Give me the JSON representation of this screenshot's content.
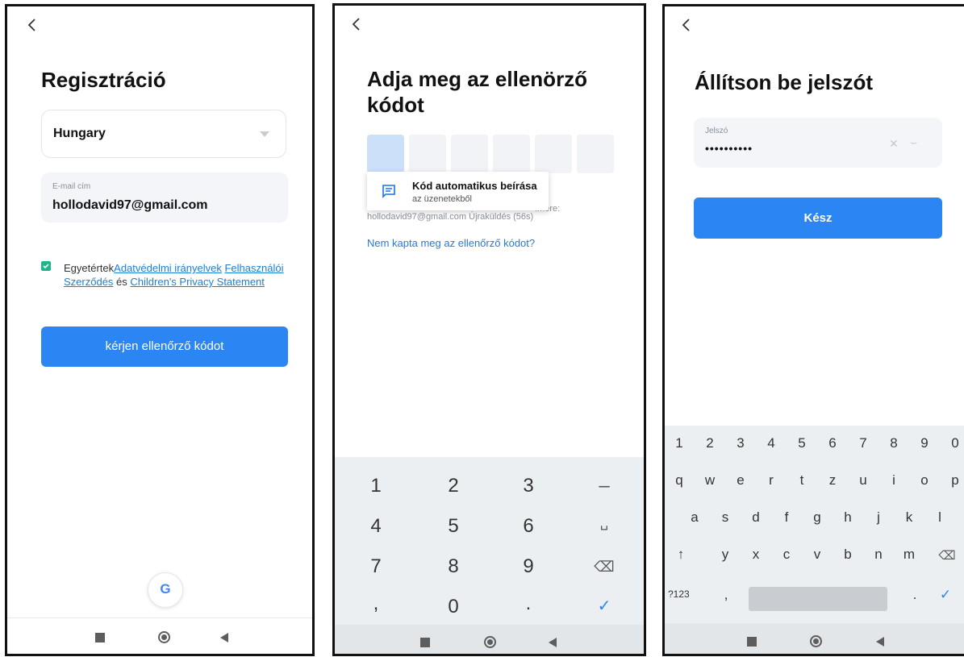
{
  "register": {
    "title": "Regisztráció",
    "country": "Hungary",
    "email_label": "E-mail cím",
    "email_value": "hollodavid97@gmail.com",
    "agree_prefix": "Egyetértek",
    "privacy_link": "Adatvédelmi irányelvek",
    "terms_link": "Felhasználói Szerződés",
    "and": "és",
    "children_link": "Children's Privacy Statement",
    "request_button": "kérjen ellenőrző kódot",
    "google_letter": "G"
  },
  "verify": {
    "title_line1": "Adja meg az ellenörző",
    "title_line2": "kódot",
    "popup_title": "Kód automatikus beírása",
    "popup_sub": "az üzenetekből",
    "sent_suffix": "ímére:",
    "sent_to": "hollodavid97@gmail.com Újraküldés (56s)",
    "not_received": "Nem kapta meg az ellenőrző kódot?",
    "keys": [
      "1",
      "2",
      "3",
      "–",
      "4",
      "5",
      "6",
      "␣",
      "7",
      "8",
      "9",
      "⌫",
      ",",
      "0",
      ".",
      "✓"
    ]
  },
  "password": {
    "title": "Állítson be jelszót",
    "field_label": "Jelszó",
    "field_value": "••••••••••",
    "done_button": "Kész",
    "numbers": [
      "1",
      "2",
      "3",
      "4",
      "5",
      "6",
      "7",
      "8",
      "9",
      "0"
    ],
    "row1": [
      "q",
      "w",
      "e",
      "r",
      "t",
      "z",
      "u",
      "i",
      "o",
      "p"
    ],
    "row2": [
      "a",
      "s",
      "d",
      "f",
      "g",
      "h",
      "j",
      "k",
      "l"
    ],
    "row3": [
      "y",
      "x",
      "c",
      "v",
      "b",
      "n",
      "m"
    ],
    "symbols_key": "?123",
    "comma_key": ",",
    "period_key": "."
  },
  "colors": {
    "primary": "#2b86f3",
    "check": "#1fb58a",
    "link": "#1a7fd8"
  }
}
